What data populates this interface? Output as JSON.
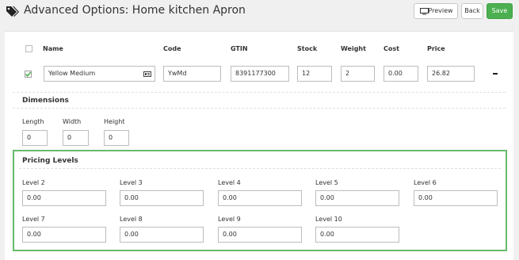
{
  "header": {
    "title": "Advanced Options:",
    "subtitle": "Home kitchen Apron",
    "buttons": {
      "preview": "Preview",
      "back": "Back",
      "save": "Save"
    }
  },
  "table": {
    "headers": [
      "Name",
      "Code",
      "GTIN",
      "Stock",
      "Weight",
      "Cost",
      "Price"
    ],
    "row": {
      "checked": true,
      "name": "Yellow Medium",
      "code": "YwMd",
      "gtin": "8391177300",
      "stock": "12",
      "weight": "2",
      "cost": "0.00",
      "price": "26.82"
    }
  },
  "dimensions": {
    "title": "Dimensions",
    "fields": [
      {
        "label": "Length",
        "value": "0"
      },
      {
        "label": "Width",
        "value": "0"
      },
      {
        "label": "Height",
        "value": "0"
      }
    ]
  },
  "pricing": {
    "title": "Pricing Levels",
    "levels": [
      {
        "label": "Level 2",
        "value": "0.00"
      },
      {
        "label": "Level 3",
        "value": "0.00"
      },
      {
        "label": "Level 4",
        "value": "0.00"
      },
      {
        "label": "Level 5",
        "value": "0.00"
      },
      {
        "label": "Level 6",
        "value": "0.00"
      },
      {
        "label": "Level 7",
        "value": "0.00"
      },
      {
        "label": "Level 8",
        "value": "0.00"
      },
      {
        "label": "Level 9",
        "value": "0.00"
      },
      {
        "label": "Level 10",
        "value": "0.00"
      }
    ]
  },
  "colors": {
    "save": "#4caf50",
    "pricing_border": "#66bb6a",
    "checkbox": "#4caf50"
  },
  "icons": {
    "title": "tags-icon",
    "preview": "monitor-icon",
    "remove": "minus-icon",
    "name_field": "id-card-icon"
  }
}
